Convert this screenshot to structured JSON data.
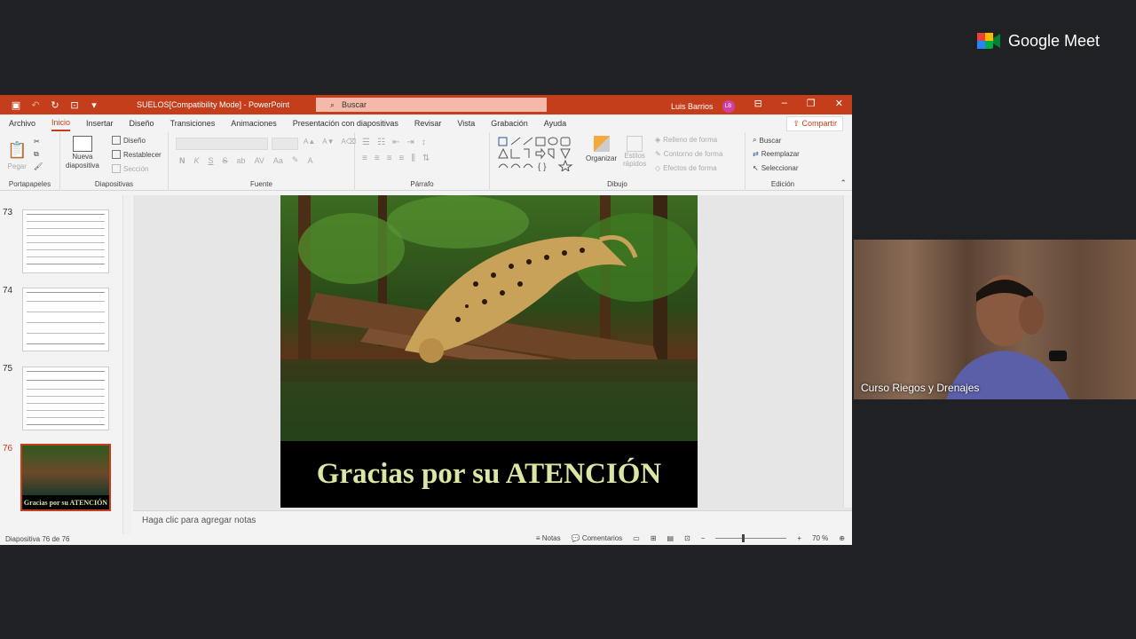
{
  "meet": {
    "brand": "Google Meet",
    "participant_name": "Curso Riegos y Drenajes"
  },
  "titlebar": {
    "document_title": "SUELOS[Compatibility Mode] - PowerPoint",
    "search_placeholder": "Buscar",
    "user_name": "Luis Barrios",
    "user_initials": "LB"
  },
  "menu": {
    "tabs": [
      "Archivo",
      "Inicio",
      "Insertar",
      "Diseño",
      "Transiciones",
      "Animaciones",
      "Presentación con diapositivas",
      "Revisar",
      "Vista",
      "Grabación",
      "Ayuda"
    ],
    "active_tab": "Inicio",
    "share_label": "Compartir"
  },
  "ribbon": {
    "portapapeles": {
      "label": "Portapapeles",
      "paste": "Pegar"
    },
    "diapositivas": {
      "label": "Diapositivas",
      "new_slide_line1": "Nueva",
      "new_slide_line2": "diapositiva",
      "layout": "Diseño",
      "reset": "Restablecer",
      "section": "Sección"
    },
    "fuente": {
      "label": "Fuente",
      "bold": "N",
      "italic": "K",
      "underline": "S",
      "strike": "S",
      "shadow": "ab",
      "spacing": "AV",
      "case": "Aa"
    },
    "parrafo": {
      "label": "Párrafo"
    },
    "dibujo": {
      "label": "Dibujo",
      "arrange": "Organizar",
      "quick_styles_line1": "Estilos",
      "quick_styles_line2": "rápidos",
      "shape_fill": "Relleno de forma",
      "shape_outline": "Contorno de forma",
      "shape_effects": "Efectos de forma"
    },
    "edicion": {
      "label": "Edición",
      "find": "Buscar",
      "replace": "Reemplazar",
      "select": "Seleccionar"
    }
  },
  "thumbnails": [
    {
      "number": "73"
    },
    {
      "number": "74"
    },
    {
      "number": "75"
    },
    {
      "number": "76",
      "caption": "Gracias por su ATENCIÓN"
    }
  ],
  "slide": {
    "caption": "Gracias por su ATENCIÓN",
    "caption_color": "#d9e6a4"
  },
  "notes_placeholder": "Haga clic para agregar notas",
  "status": {
    "slide_counter": "Diapositiva 76 de 76",
    "notes": "Notas",
    "comments": "Comentarios",
    "zoom": "70 %"
  },
  "colors": {
    "accent": "#c43e1c",
    "meet_bg": "#202124"
  }
}
